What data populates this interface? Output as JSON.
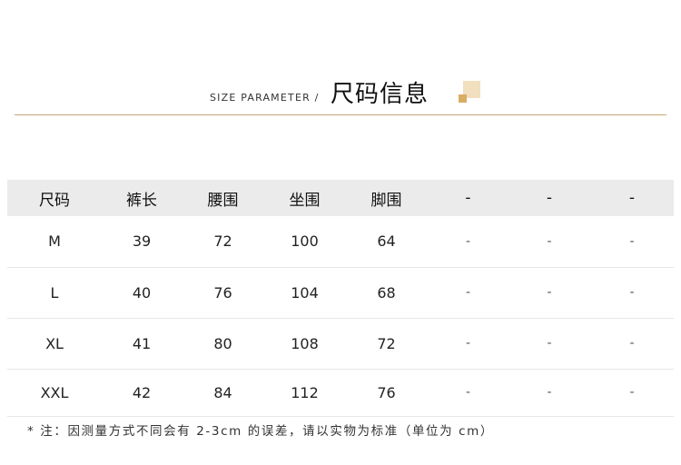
{
  "header": {
    "subtitle": "SIZE PARAMETER /",
    "title": "尺码信息"
  },
  "table": {
    "headers": [
      "尺码",
      "裤长",
      "腰围",
      "坐围",
      "脚围",
      "-",
      "-",
      "-"
    ],
    "rows": [
      [
        "M",
        "39",
        "72",
        "100",
        "64",
        "-",
        "-",
        "-"
      ],
      [
        "L",
        "40",
        "76",
        "104",
        "68",
        "-",
        "-",
        "-"
      ],
      [
        "XL",
        "41",
        "80",
        "108",
        "72",
        "-",
        "-",
        "-"
      ],
      [
        "XXL",
        "42",
        "84",
        "112",
        "76",
        "-",
        "-",
        "-"
      ]
    ]
  },
  "note": "* 注：因测量方式不同会有 2-3cm 的误差，请以实物为标准（单位为 cm）",
  "colors": {
    "accent_line": "#c9a67a",
    "deco_light": "#f1dfc0",
    "deco_dark": "#d9ad63",
    "header_row_bg": "#ebebeb"
  }
}
